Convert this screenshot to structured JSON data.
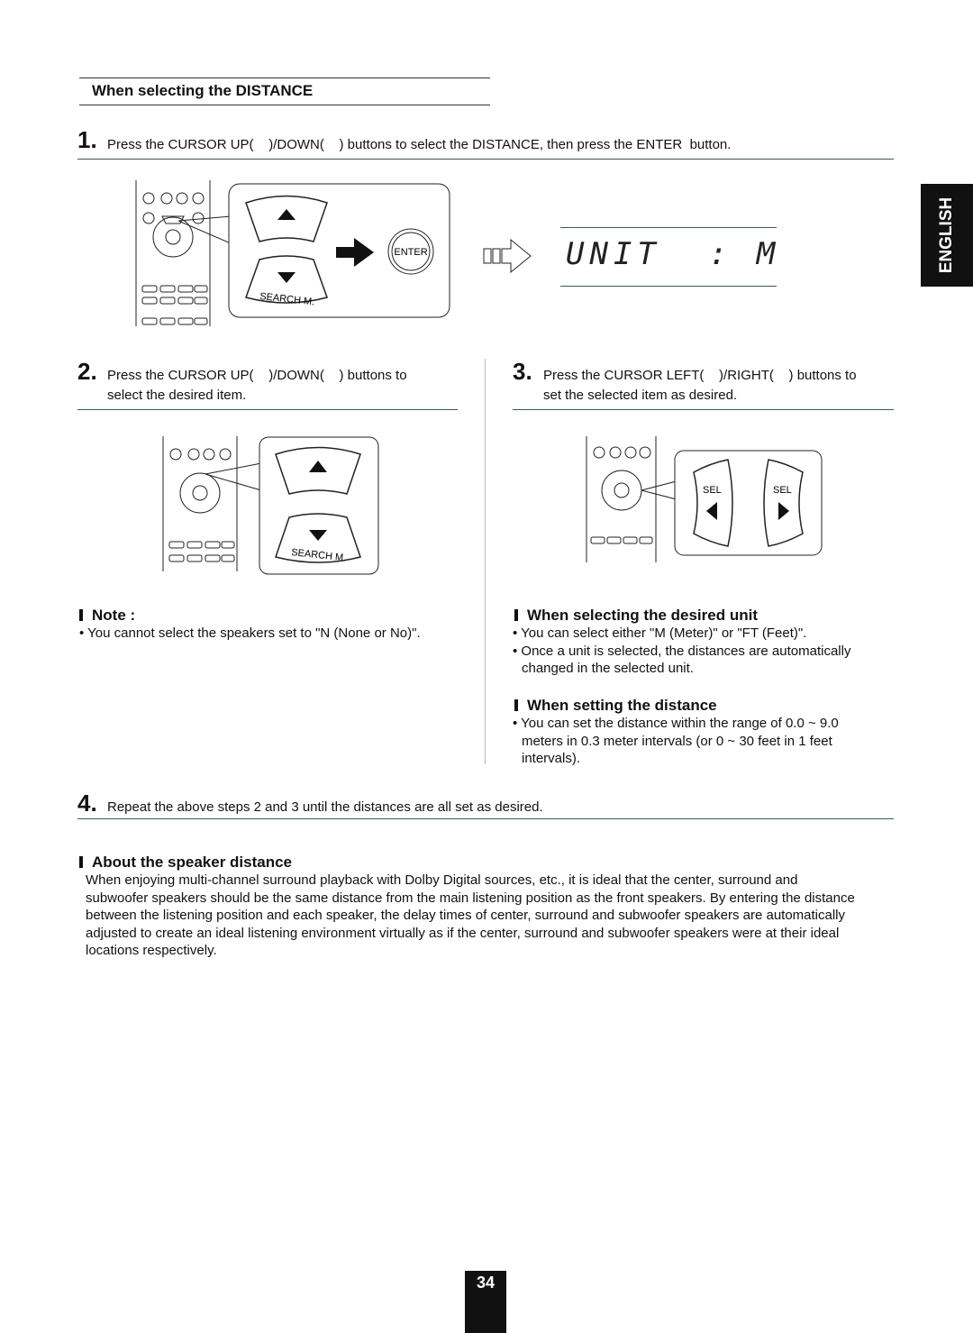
{
  "section_title": "When selecting the DISTANCE",
  "side_tab": "ENGLISH",
  "steps": [
    {
      "num": "1.",
      "text": "Press the CURSOR UP(    )/DOWN(    ) buttons to select the DISTANCE, then press the ENTER  button."
    },
    {
      "num": "2.",
      "line1": "Press the CURSOR UP(    )/DOWN(    ) buttons to",
      "line2": "select the desired item."
    },
    {
      "num": "3.",
      "line1": "Press the CURSOR LEFT(    )/RIGHT(    ) buttons to",
      "line2": "set the selected item as desired."
    },
    {
      "num": "4.",
      "text": "Repeat the above steps 2 and 3 until the distances are all set as desired."
    }
  ],
  "illustration": {
    "enter_label": "ENTER",
    "search_label": "SEARCH M.",
    "sel_label": "SEL",
    "display_text": "UNIT  : M"
  },
  "note": {
    "title": "Note :",
    "bullets": [
      "You cannot select the speakers set to \"N (None or No)\"."
    ]
  },
  "unit": {
    "title": "When selecting the desired unit",
    "bullets": [
      "You can select either \"M (Meter)\" or \"FT (Feet)\".",
      "Once a unit is selected, the distances are automatically",
      "changed in the selected unit."
    ]
  },
  "setting": {
    "title": "When setting the distance",
    "lines": [
      "You can set the distance within the range of 0.0 ~ 9.0",
      "meters in 0.3 meter intervals (or 0 ~ 30 feet in 1 feet",
      "intervals)."
    ]
  },
  "about": {
    "title": "About the speaker distance",
    "lines": [
      "When enjoying multi-channel surround playback with Dolby Digital sources, etc., it is ideal that the center, surround and",
      "subwoofer speakers should be the same distance from the main listening position as the front speakers. By entering the distance",
      "between the listening position and each speaker, the delay times of center, surround and subwoofer speakers are automatically",
      "adjusted to create an ideal listening environment virtually as if the center, surround and subwoofer speakers were at their ideal",
      "locations respectively."
    ]
  },
  "page_number": "34"
}
